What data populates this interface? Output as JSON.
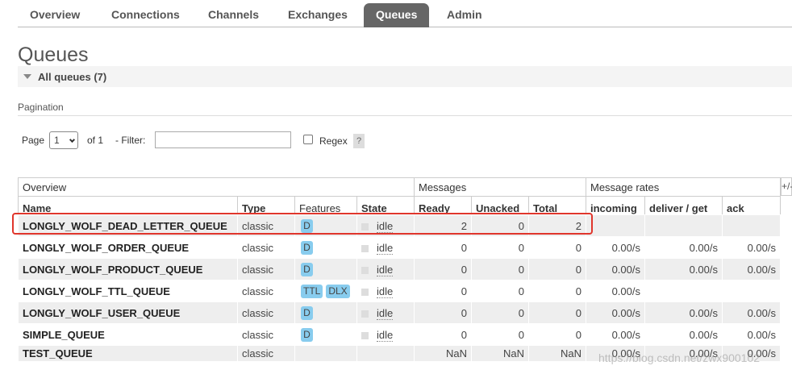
{
  "nav": {
    "tabs": [
      "Overview",
      "Connections",
      "Channels",
      "Exchanges",
      "Queues",
      "Admin"
    ],
    "active": "Queues"
  },
  "page": {
    "title": "Queues",
    "section_label": "All queues (7)"
  },
  "pagination": {
    "label": "Pagination",
    "page_label": "Page",
    "page_value": "1",
    "of_label": "of 1",
    "filter_label": "- Filter:",
    "filter_value": "",
    "regex_label": "Regex",
    "help_label": "?"
  },
  "table": {
    "groups": [
      "Overview",
      "Messages",
      "Message rates"
    ],
    "plusminus": "+/-",
    "columns": [
      "Name",
      "Type",
      "Features",
      "State",
      "Ready",
      "Unacked",
      "Total",
      "incoming",
      "deliver / get",
      "ack"
    ],
    "rows": [
      {
        "name": "LONGLY_WOLF_DEAD_LETTER_QUEUE",
        "type": "classic",
        "features": [
          "D"
        ],
        "state": "idle",
        "ready": "2",
        "unacked": "0",
        "total": "2",
        "incoming": "",
        "deliver": "",
        "ack": ""
      },
      {
        "name": "LONGLY_WOLF_ORDER_QUEUE",
        "type": "classic",
        "features": [
          "D"
        ],
        "state": "idle",
        "ready": "0",
        "unacked": "0",
        "total": "0",
        "incoming": "0.00/s",
        "deliver": "0.00/s",
        "ack": "0.00/s"
      },
      {
        "name": "LONGLY_WOLF_PRODUCT_QUEUE",
        "type": "classic",
        "features": [
          "D"
        ],
        "state": "idle",
        "ready": "0",
        "unacked": "0",
        "total": "0",
        "incoming": "0.00/s",
        "deliver": "0.00/s",
        "ack": "0.00/s"
      },
      {
        "name": "LONGLY_WOLF_TTL_QUEUE",
        "type": "classic",
        "features": [
          "TTL",
          "DLX"
        ],
        "state": "idle",
        "ready": "0",
        "unacked": "0",
        "total": "0",
        "incoming": "0.00/s",
        "deliver": "",
        "ack": ""
      },
      {
        "name": "LONGLY_WOLF_USER_QUEUE",
        "type": "classic",
        "features": [
          "D"
        ],
        "state": "idle",
        "ready": "0",
        "unacked": "0",
        "total": "0",
        "incoming": "0.00/s",
        "deliver": "0.00/s",
        "ack": "0.00/s"
      },
      {
        "name": "SIMPLE_QUEUE",
        "type": "classic",
        "features": [
          "D"
        ],
        "state": "idle",
        "ready": "0",
        "unacked": "0",
        "total": "0",
        "incoming": "0.00/s",
        "deliver": "0.00/s",
        "ack": "0.00/s"
      },
      {
        "name": "TEST_QUEUE",
        "type": "classic",
        "features": [],
        "state": "",
        "ready": "NaN",
        "unacked": "NaN",
        "total": "NaN",
        "incoming": "0.00/s",
        "deliver": "0.00/s",
        "ack": "0.00/s"
      }
    ]
  },
  "watermark": "https://blog.csdn.net/zwx900102",
  "colors": {
    "active_tab": "#666666",
    "feature_badge": "#88ccee",
    "highlight": "#e0362c"
  }
}
